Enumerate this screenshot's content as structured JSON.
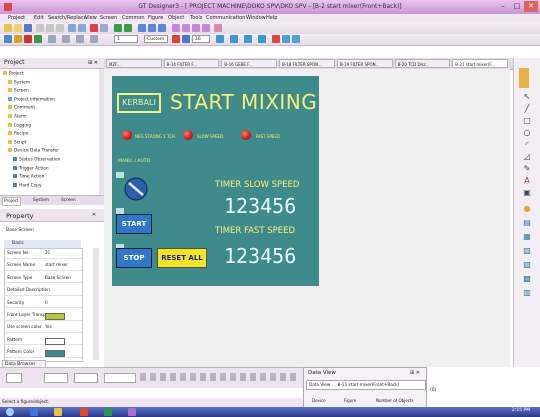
{
  "window": {
    "title": "GT Designer3 - [ PROJECT MACHINE\\DOKO SPV\\DKO SPV - [B-2 start mixer(Front+Back)]",
    "controls": [
      "–",
      "□",
      "✕"
    ]
  },
  "menu": [
    "Project",
    "Edit",
    "Search/Replace",
    "View",
    "Screen",
    "Common",
    "Figure",
    "Object",
    "Tools",
    "Communication",
    "Window",
    "Help"
  ],
  "toolbar": {
    "zoom_value": "1",
    "font_value": "Custom",
    "size_value": "16"
  },
  "project_panel": {
    "title": "Project",
    "tree": [
      {
        "label": "Project",
        "indent": 0,
        "icon": "folder-icon"
      },
      {
        "label": "System",
        "indent": 1,
        "icon": "folder-icon"
      },
      {
        "label": "Screen",
        "indent": 1,
        "icon": "folder-icon"
      },
      {
        "label": "Project Information",
        "indent": 1,
        "icon": "doc-icon"
      },
      {
        "label": "Comment",
        "indent": 1,
        "icon": "folder-icon"
      },
      {
        "label": "Alarm",
        "indent": 1,
        "icon": "folder-icon"
      },
      {
        "label": "Logging",
        "indent": 1,
        "icon": "folder-icon"
      },
      {
        "label": "Recipe",
        "indent": 1,
        "icon": "folder-icon"
      },
      {
        "label": "Script",
        "indent": 1,
        "icon": "folder-icon"
      },
      {
        "label": "Device Data Transfer",
        "indent": 1,
        "icon": "folder-icon"
      },
      {
        "label": "Status Observation",
        "indent": 2,
        "icon": "gear-icon"
      },
      {
        "label": "Trigger Action",
        "indent": 2,
        "icon": "gear-icon"
      },
      {
        "label": "Time Action",
        "indent": 2,
        "icon": "gear-icon"
      },
      {
        "label": "Hard Copy",
        "indent": 2,
        "icon": "gear-icon"
      }
    ],
    "tabs": [
      "Project",
      "System",
      "Screen"
    ]
  },
  "property_panel": {
    "title": "Property",
    "subtitle": "Base Screen",
    "section": "Basic",
    "rows": [
      {
        "key": "Screen No.",
        "value": "21"
      },
      {
        "key": "Screen Name",
        "value": "start mixer"
      },
      {
        "key": "Screen Type",
        "value": "Base Screen"
      },
      {
        "key": "Detailed Description",
        "value": ""
      },
      {
        "key": "Security",
        "value": "0"
      },
      {
        "key": "Front Layer Transparent",
        "value": ""
      },
      {
        "key": "Use screen color",
        "value": "Yes"
      },
      {
        "key": "Pattern",
        "value": ""
      },
      {
        "key": "Pattern Color",
        "value": ""
      }
    ]
  },
  "screen_tabs": [
    "MZF...",
    "B-14 FILTER F...",
    "B-16 GEBE F...",
    "B-18 FILTER SPON...",
    "B-19 FILTER SPON...",
    "B-20 TCD Disc...",
    "B-21 start mixer(F..."
  ],
  "hmi": {
    "kerbal_label": "KERBALI",
    "title": "START MIXING",
    "lamps": [
      "NEG STRONG 1 TCH",
      "SLOW SPEED",
      "FAST SPEED"
    ],
    "manual_auto": "MANU. / AUTO",
    "timer_slow_label": "TIMER SLOW SPEED",
    "timer_slow_value": "123456",
    "start_label": "START",
    "timer_fast_label": "TIMER FAST SPEED",
    "timer_fast_value": "123456",
    "stop_label": "STOP",
    "reset_label": "RESET ALL"
  },
  "bottom": {
    "data_browser_tab": "Data Browser",
    "data_view_title": "Data View",
    "data_view_col1": "Data View",
    "data_view_col2": "B-21 start mixer(Front+Back)",
    "data_view_sub": [
      "Device",
      "Figure",
      "Number of Objects"
    ],
    "status_text": "Select a figure/object.",
    "coord": "(0)",
    "clock": "2:15 PM"
  },
  "colors": {
    "screen_bg": "#3f8a8b",
    "accent_yellow": "#f5f07a",
    "start_button": "#2f77c9",
    "stop_button": "#2f77c9",
    "reset_button": "#f3e22a"
  }
}
